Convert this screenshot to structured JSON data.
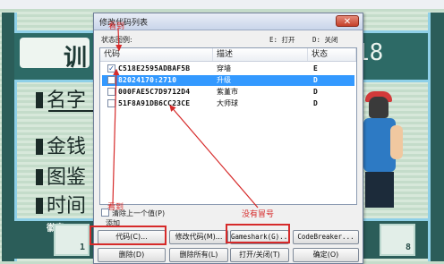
{
  "background": {
    "title": "训",
    "trainer_id": "18",
    "labels": [
      "名字",
      "金钱",
      "图鉴",
      "时间"
    ],
    "badge_word": "徽章",
    "badge_left": "1",
    "badge_right": "8"
  },
  "dialog": {
    "title": "修改代码列表",
    "close_symbol": "✕",
    "legend": {
      "label": "状态图例:",
      "on": "E: 打开",
      "off": "D: 关闭"
    },
    "columns": [
      "代码",
      "描述",
      "状态"
    ],
    "rows": [
      {
        "checked": true,
        "code": "C518E2595ADBAF5B",
        "desc": "穿墙",
        "status": "E",
        "selected": false
      },
      {
        "checked": false,
        "code": "82024170:2710",
        "desc": "升级",
        "status": "D",
        "selected": true
      },
      {
        "checked": false,
        "code": "000FAE5C7D9712D4",
        "desc": "紫堇市",
        "status": "D",
        "selected": false
      },
      {
        "checked": false,
        "code": "51F8A91DB6CC23CE",
        "desc": "大师球",
        "status": "D",
        "selected": false
      }
    ],
    "option_label": "清除上一个值(P)",
    "add_group_label": "添加",
    "buttons": {
      "code": "代码(C)...",
      "modify": "修改代码(M)...",
      "gameshark": "Gameshark(G)...",
      "codebreaker": "CodeBreaker...",
      "delete": "删除(D)",
      "delete_all": "删除所有(L)",
      "toggle": "打开/关闭(T)",
      "ok": "确定(O)"
    }
  },
  "annotations": {
    "top": "看到",
    "left": "看到",
    "right": "没有冒号"
  },
  "colors": {
    "accent_red": "#d62a2a",
    "selection": "#3399ff"
  }
}
